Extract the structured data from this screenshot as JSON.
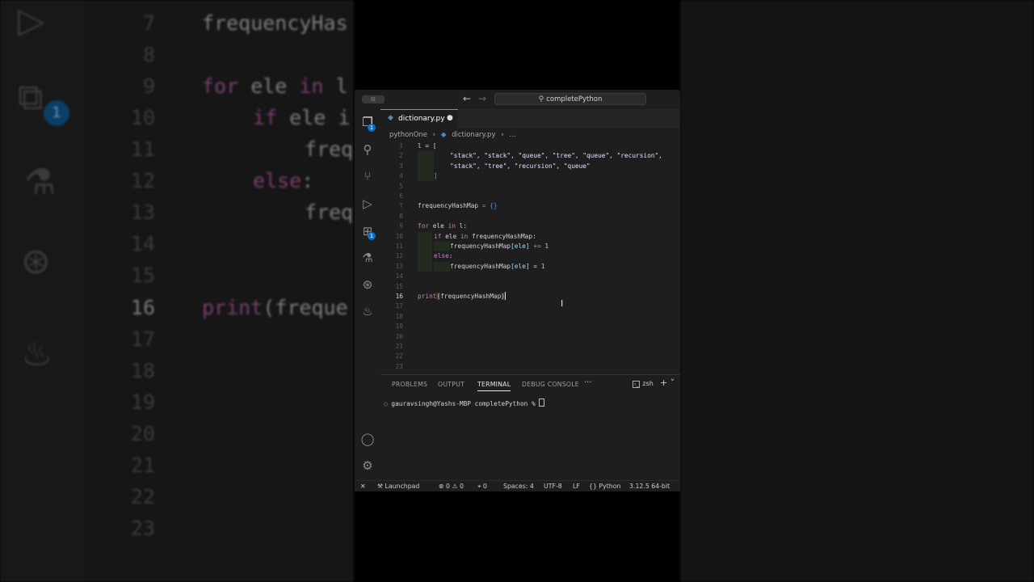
{
  "background": {
    "line_numbers": [
      "7",
      "8",
      "9",
      "10",
      "11",
      "12",
      "13",
      "14",
      "15",
      "16",
      "17",
      "18",
      "19",
      "20",
      "21",
      "22",
      "23"
    ],
    "current_line": "16",
    "code_fragments": {
      "line7": "frequencyHas",
      "line9_kw": "for",
      "line9_rest": " ele ",
      "line9_kw2": "in",
      "line9_tail": " l",
      "line10_kw": "if",
      "line10_rest": " ele i",
      "line11": "freq",
      "line12_kw": "else",
      "line12_rest": ":",
      "line13": "freq",
      "line16_fn": "print",
      "line16_rest": "(freque"
    },
    "badge": "1"
  },
  "window": {
    "command_center": "completePython",
    "sidebar_toggle": "⊟"
  },
  "activity_bar": {
    "explorer_badge": "1",
    "extensions_badge": "1"
  },
  "tab": {
    "label": "dictionary.py",
    "dirty": "●"
  },
  "breadcrumb": {
    "folder": "pythonOne",
    "sep1": "›",
    "file": "dictionary.py",
    "sep2": "›",
    "more": "..."
  },
  "editor": {
    "current_line": 16,
    "line_numbers": [
      "1",
      "2",
      "3",
      "4",
      "5",
      "6",
      "7",
      "8",
      "9",
      "10",
      "11",
      "12",
      "13",
      "14",
      "15",
      "16",
      "17",
      "18",
      "19",
      "20",
      "21",
      "22",
      "23"
    ],
    "code": {
      "l1": "l = [",
      "l2": "\"stack\", \"stack\", \"queue\", \"tree\", \"queue\", \"recursion\",",
      "l3": "\"stack\", \"tree\", \"recursion\", \"queue\"",
      "l4": "]",
      "l7_name": "frequencyHashMap",
      "l7_rest": " = {}",
      "l9_kw": "for",
      "l9_mid": " ele ",
      "l9_kw2": "in",
      "l9_tail": " l:",
      "l10_kw": "if",
      "l10_mid": " ele ",
      "l10_kw2": "in",
      "l10_tail": " frequencyHashMap:",
      "l11_a": "frequencyHashMap",
      "l11_b": "[ele]",
      "l11_op": " += ",
      "l11_n": "1",
      "l12_kw": "else",
      "l12_tail": ":",
      "l13_a": "frequencyHashMap",
      "l13_b": "[ele]",
      "l13_op": " = ",
      "l13_n": "1",
      "l16_fn": "print",
      "l16_open": "(",
      "l16_arg": "frequencyHashMap",
      "l16_close": ")"
    }
  },
  "panel": {
    "tabs": [
      "PROBLEMS",
      "OUTPUT",
      "TERMINAL",
      "DEBUG CONSOLE"
    ],
    "active_tab": "TERMINAL",
    "more": "···",
    "shell": "zsh",
    "add": "+ ˅",
    "prompt": "gauravsingh@Yashs-MBP completePython % "
  },
  "status_bar": {
    "remote": "✕",
    "launchpad": "Launchpad",
    "errors": "0",
    "warnings": "0",
    "ports": "0",
    "spaces": "Spaces: 4",
    "encoding": "UTF-8",
    "eol": "LF",
    "language": "Python",
    "interpreter": "3.12.5 64-bit"
  },
  "colors": {
    "keyword": "#c586c0",
    "accent_blue": "#0e6fc7",
    "tab_border": "#d26c8a"
  }
}
